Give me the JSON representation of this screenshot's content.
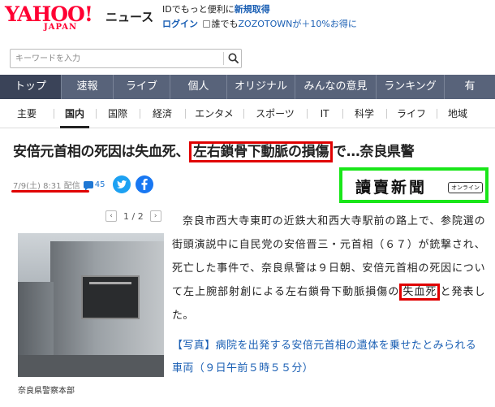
{
  "header": {
    "logo_main": "YAHOO!",
    "logo_sub": "JAPAN",
    "logo_news": "ニュース",
    "promo_line1_prefix": "IDでもっと便利に",
    "promo_line1_link": "新規取得",
    "promo_login": "ログイン",
    "promo_line2_a": "誰でも",
    "promo_line2_b": "ZOZOTOWN",
    "promo_line2_c": "が＋10%お得に"
  },
  "search": {
    "placeholder": "キーワードを入力"
  },
  "mainnav": [
    {
      "label": "トップ",
      "active": true
    },
    {
      "label": "速報"
    },
    {
      "label": "ライブ"
    },
    {
      "label": "個人"
    },
    {
      "label": "オリジナル"
    },
    {
      "label": "みんなの意見"
    },
    {
      "label": "ランキング"
    },
    {
      "label": "有"
    }
  ],
  "subnav": [
    {
      "label": "主要"
    },
    {
      "label": "国内",
      "active": true
    },
    {
      "label": "国際"
    },
    {
      "label": "経済"
    },
    {
      "label": "エンタメ"
    },
    {
      "label": "スポーツ"
    },
    {
      "label": "IT"
    },
    {
      "label": "科学"
    },
    {
      "label": "ライフ"
    },
    {
      "label": "地域"
    }
  ],
  "article": {
    "title_a": "安倍元首相の死因は失血死、",
    "title_hl": "左右鎖骨下動脈の損傷",
    "title_b": "で…奈良県警",
    "date": "7/9(土) 8:31 配信",
    "comment_count": "45",
    "source_name": "讀賣新聞",
    "source_badge": "オンライン",
    "pager": "1 / 2",
    "photo_caption": "奈良県警察本部",
    "body_a": "奈良市西大寺東町の近鉄大和西大寺駅前の路上で、参院選の街頭演説中に自民党の安倍晋三・元首相（６７）が銃撃され、死亡した事件で、奈良県警は９日朝、安倍元首相の死因について左上腕部射創による左右鎖骨下動脈損傷の",
    "body_hl": "失血死",
    "body_b": "と発表した。",
    "related": "【写真】病院を出発する安倍元首相の遺体を乗せたとみられる車両（９日午前５時５５分）"
  }
}
